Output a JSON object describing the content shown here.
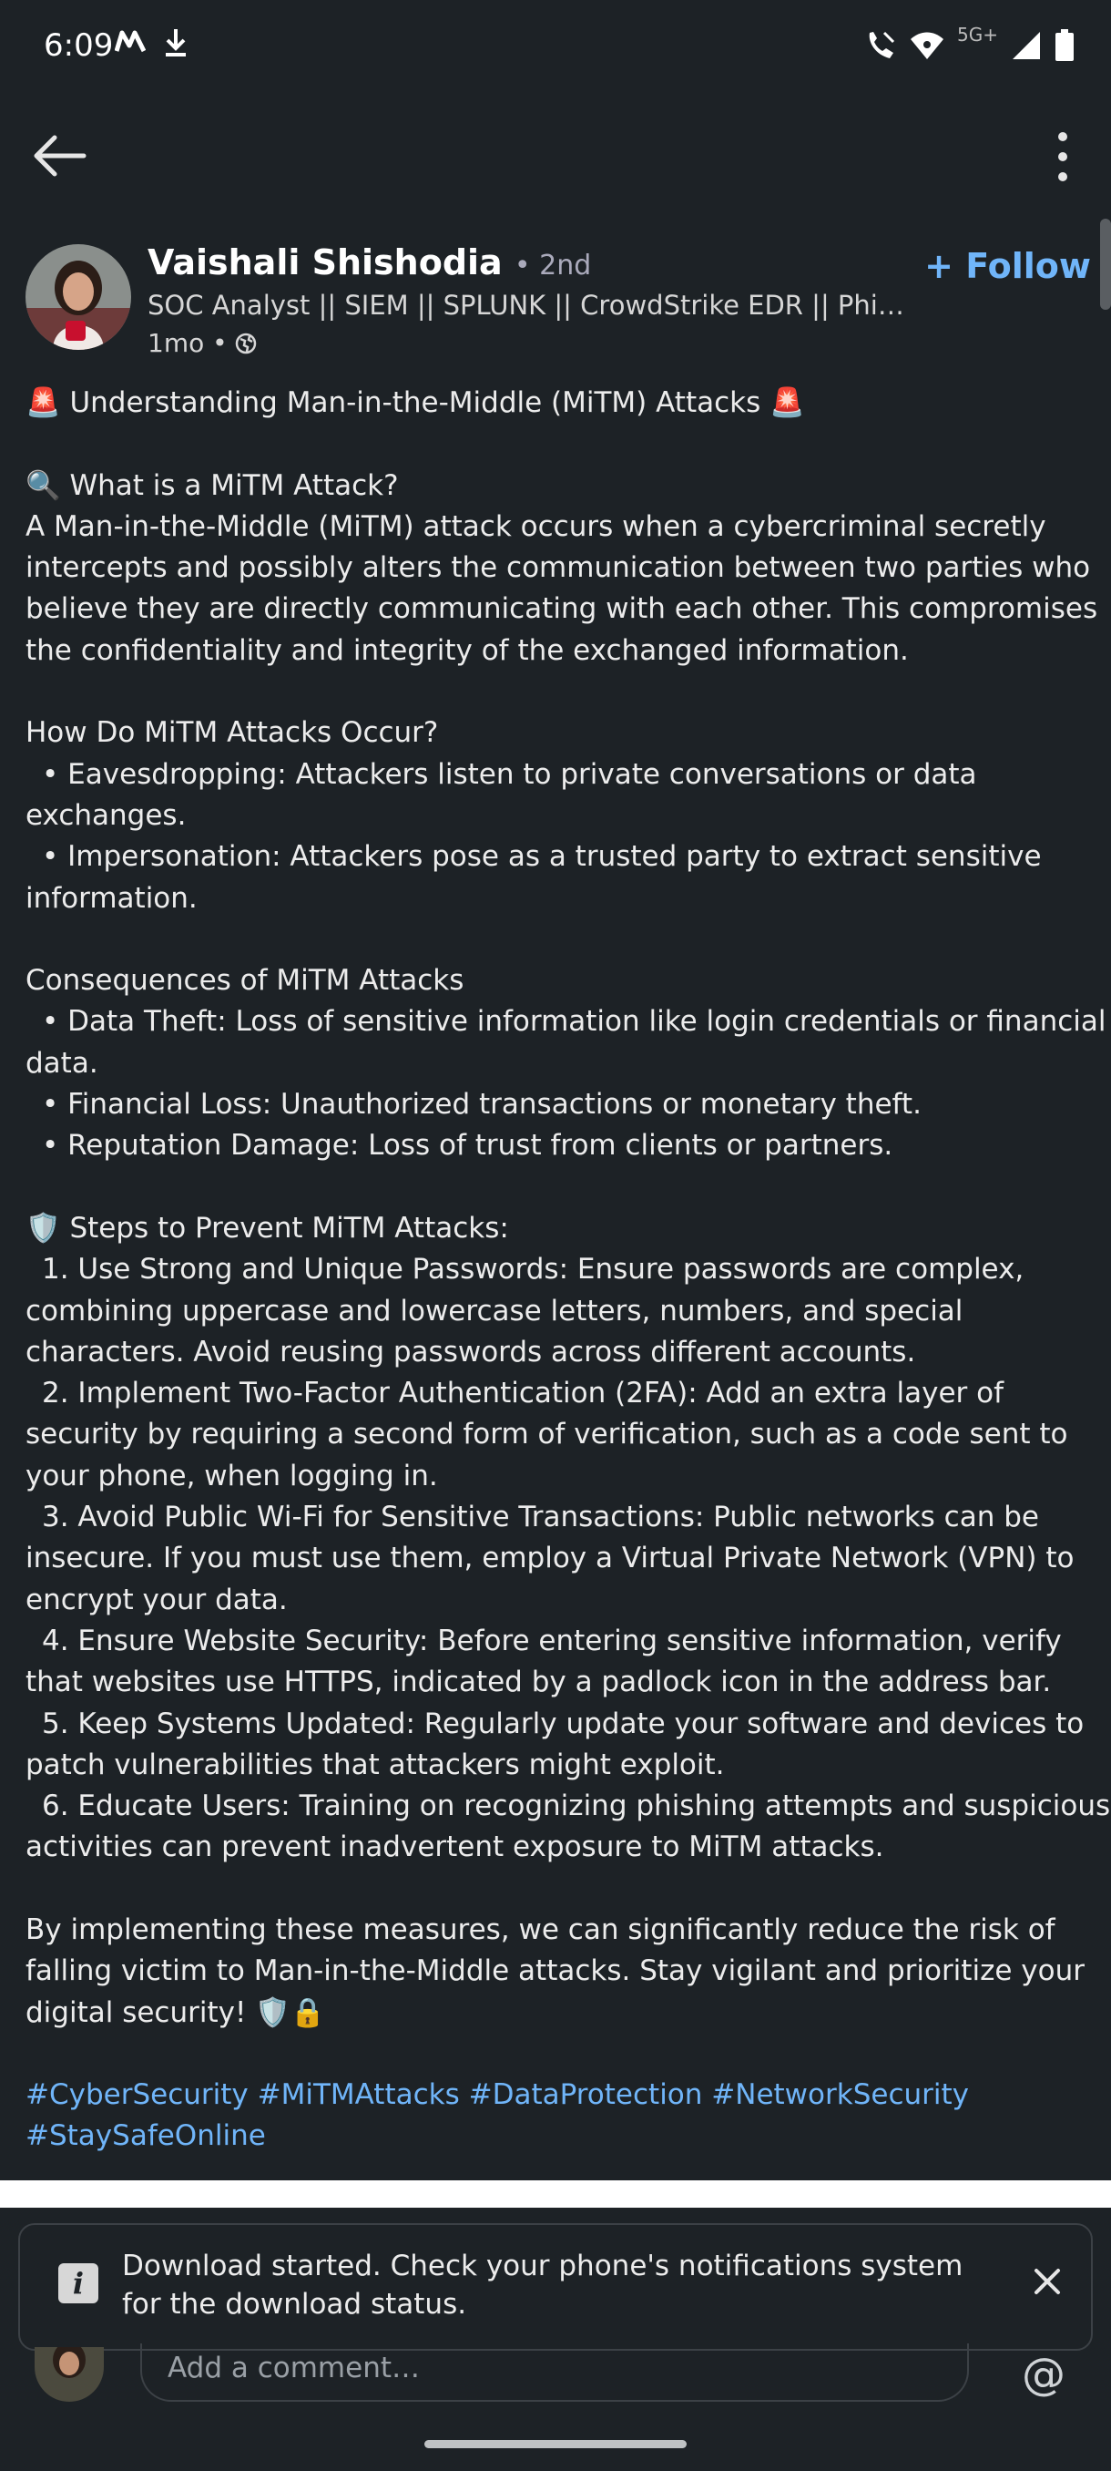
{
  "status_bar": {
    "time": "6:09",
    "network": "5G+",
    "icons": [
      "m-notification-icon",
      "download-icon",
      "wifi-calling-icon",
      "wifi-icon",
      "signal-icon",
      "battery-icon"
    ]
  },
  "app_bar": {
    "back_icon": "arrow-left-icon",
    "more_icon": "more-vertical-icon"
  },
  "author": {
    "name": "Vaishali Shishodia",
    "degree": "• 2nd",
    "headline": "SOC Analyst || SIEM || SPLUNK || CrowdStrike EDR || Phishing Analysis || Cyber Security",
    "time": "1mo •",
    "follow_label": "+ Follow"
  },
  "post": {
    "lines": [
      "🚨 Understanding Man-in-the-Middle (MiTM) Attacks 🚨",
      "",
      "🔍 What is a MiTM Attack?",
      "A Man-in-the-Middle (MiTM) attack occurs when a cybercriminal secretly",
      "intercepts and possibly alters the communication between two parties who",
      "believe they are directly communicating with each other. This compromises",
      "the confidentiality and integrity of the exchanged information.",
      "",
      "How Do MiTM Attacks Occur?",
      "  • Eavesdropping: Attackers listen to private conversations or data",
      "exchanges.",
      "  • Impersonation: Attackers pose as a trusted party to extract sensitive",
      "information.",
      "",
      "Consequences of MiTM Attacks",
      "  • Data Theft: Loss of sensitive information like login credentials or financial",
      "data.",
      "  • Financial Loss: Unauthorized transactions or monetary theft.",
      "  • Reputation Damage: Loss of trust from clients or partners.",
      "",
      "🛡️ Steps to Prevent MiTM Attacks:",
      "  1. Use Strong and Unique Passwords: Ensure passwords are complex,",
      "combining uppercase and lowercase letters, numbers, and special",
      "characters. Avoid reusing passwords across different accounts.",
      "  2. Implement Two-Factor Authentication (2FA): Add an extra layer of",
      "security by requiring a second form of verification, such as a code sent to",
      "your phone, when logging in.",
      "  3. Avoid Public Wi-Fi for Sensitive Transactions: Public networks can be",
      "insecure. If you must use them, employ a Virtual Private Network (VPN) to",
      "encrypt your data.",
      "  4. Ensure Website Security: Before entering sensitive information, verify",
      "that websites use HTTPS, indicated by a padlock icon in the address bar.",
      "  5. Keep Systems Updated: Regularly update your software and devices to",
      "patch vulnerabilities that attackers might exploit.",
      "  6. Educate Users: Training on recognizing phishing attempts and suspicious",
      "activities can prevent inadvertent exposure to MiTM attacks.",
      "",
      "By implementing these measures, we can significantly reduce the risk of",
      "falling victim to Man-in-the-Middle attacks. Stay vigilant and prioritize your",
      "digital security! 🛡️🔒",
      ""
    ],
    "hashtag_lines": [
      "#CyberSecurity #MiTMAttacks #DataProtection #NetworkSecurity",
      "#StaySafeOnline"
    ]
  },
  "toast": {
    "icon": "info-icon",
    "message": "Download started. Check your phone's notifications system for the download status.",
    "close_icon": "close-icon"
  },
  "comment_bar": {
    "placeholder": "Add a comment…",
    "mention_symbol": "@"
  },
  "colors": {
    "background": "#1d2226",
    "link": "#70b5f9",
    "text": "#ececec"
  }
}
